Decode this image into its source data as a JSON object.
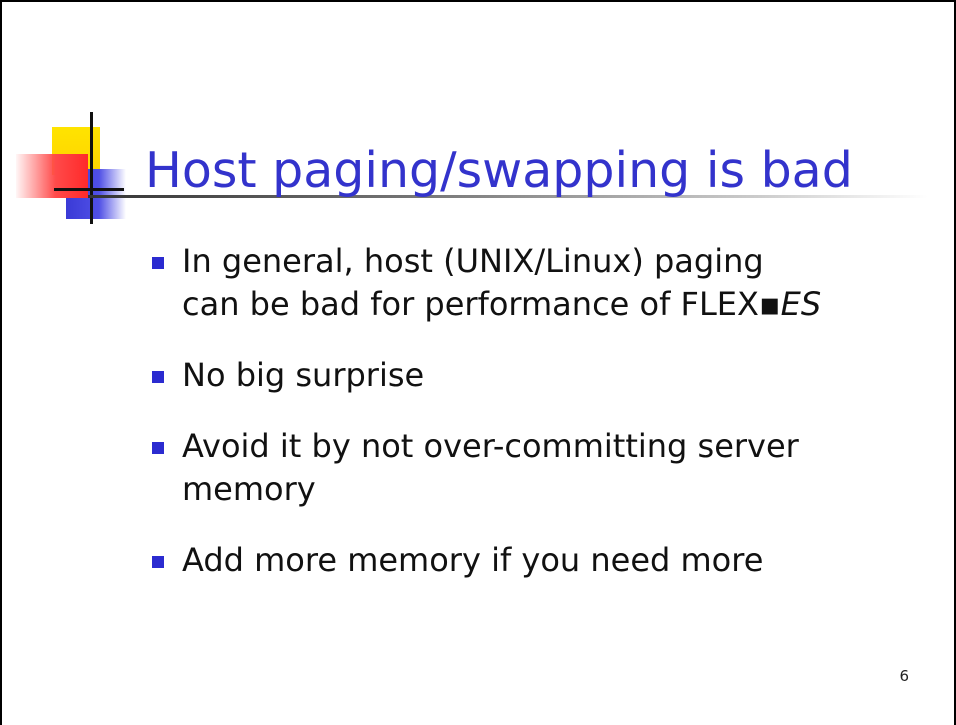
{
  "slide": {
    "title": "Host paging/swapping is bad",
    "bullets": [
      {
        "lines": [
          "In general, host (UNIX/Linux) paging",
          "can be bad for performance of FLEX▪"
        ],
        "emphasis": "ES"
      },
      {
        "lines": [
          "No big surprise"
        ]
      },
      {
        "lines": [
          "Avoid it by not over-committing server",
          "memory"
        ]
      },
      {
        "lines": [
          "Add more memory if you need more"
        ]
      }
    ],
    "page_number": "6"
  },
  "colors": {
    "title": "#3333cc",
    "bullet_marker": "#2b2bd0",
    "logo_yellow": "#ffd200",
    "logo_blue": "#3a3ad6",
    "logo_red": "#ff2a2a"
  },
  "icons": {
    "bullet": "square-bullet-icon",
    "logo": "slide-logo-icon"
  }
}
